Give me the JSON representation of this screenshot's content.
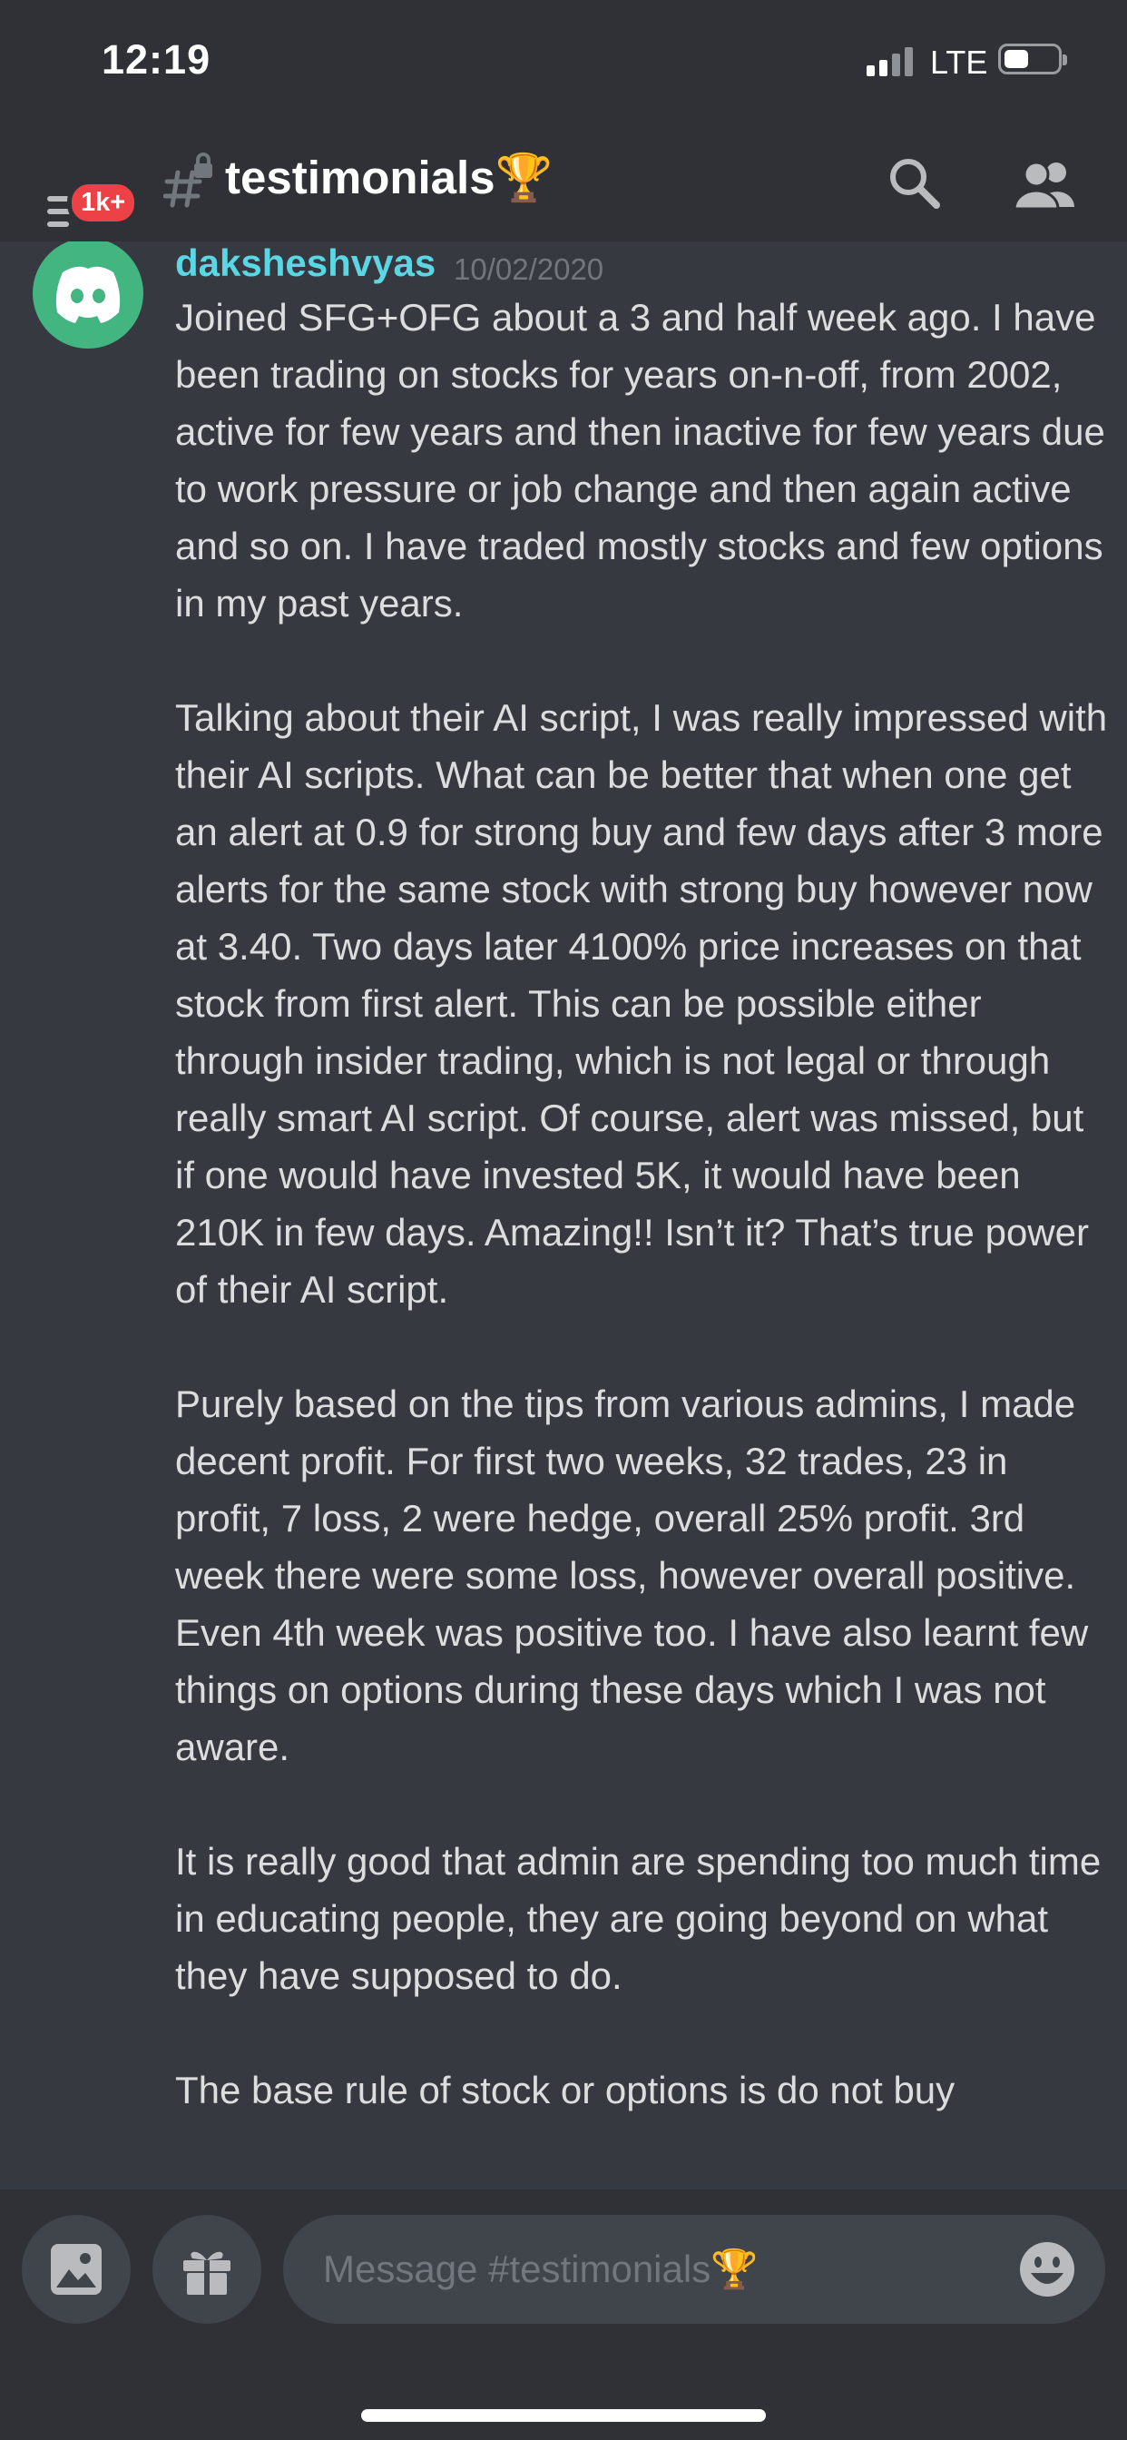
{
  "status_bar": {
    "time": "12:19",
    "network": "LTE",
    "signal_bars": 2,
    "battery_level": 0.4
  },
  "header": {
    "unread_badge": "1k+",
    "channel_name": "testimonials🏆",
    "icons": [
      "menu-icon",
      "locked-hash-icon",
      "search-icon",
      "members-icon"
    ]
  },
  "message": {
    "username": "daksheshvyas",
    "timestamp": "10/02/2020",
    "paragraphs": [
      "Joined SFG+OFG about a 3 and half week ago. I have been trading on stocks for years on-n-off, from 2002, active for few years and then inactive for few years due to work pressure or job change and then again active and so on. I have traded mostly stocks and few options in my past years.",
      "Talking about their AI script, I was really impressed with their AI scripts. What can be better that when one get an alert at 0.9 for strong buy and few days after 3 more alerts for the same stock with strong buy however now at 3.40. Two days later 4100% price increases on that stock from first alert. This can be possible either through insider trading, which is not legal or through really smart AI script. Of course, alert was missed, but if one would have invested 5K, it would have been 210K in few days. Amazing!! Isn’t it? That’s true power of their AI script.",
      "Purely based on the tips from various admins, I made decent profit. For first two weeks, 32 trades, 23 in profit, 7 loss, 2 were hedge, overall 25% profit. 3rd week there were some loss, however overall positive. Even 4th week was positive too. I have also learnt few things on options during these days which I was not aware.",
      "It is really good that admin are spending too much time in educating people, they are going beyond on what they have supposed to do.",
      "The base rule of stock or options is do not buy"
    ]
  },
  "composer": {
    "placeholder": "Message #testimonials🏆"
  },
  "colors": {
    "background": "#36393f",
    "header": "#2f3136",
    "username": "#5ad7e4",
    "avatar": "#43b581",
    "badge": "#ed4245"
  }
}
